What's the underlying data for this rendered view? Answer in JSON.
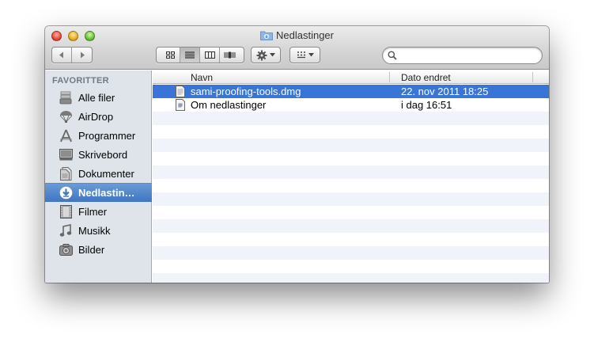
{
  "window": {
    "title": "Nedlastinger",
    "title_icon": "downloads-folder-icon"
  },
  "toolbar": {
    "back_icon": "chevron-left-icon",
    "forward_icon": "chevron-right-icon",
    "view_modes": [
      "icon-view",
      "list-view",
      "column-view",
      "cover-flow-view"
    ],
    "active_view": "list-view",
    "action_icon": "gear-icon",
    "arrange_icon": "arrange-icon",
    "search": {
      "value": "",
      "placeholder": ""
    }
  },
  "sidebar": {
    "heading": "FAVORITTER",
    "items": [
      {
        "label": "Alle filer",
        "icon": "all-files-icon",
        "selected": false
      },
      {
        "label": "AirDrop",
        "icon": "airdrop-icon",
        "selected": false
      },
      {
        "label": "Programmer",
        "icon": "applications-icon",
        "selected": false
      },
      {
        "label": "Skrivebord",
        "icon": "desktop-icon",
        "selected": false
      },
      {
        "label": "Dokumenter",
        "icon": "documents-icon",
        "selected": false
      },
      {
        "label": "Nedlastin…",
        "icon": "downloads-icon",
        "selected": true
      },
      {
        "label": "Filmer",
        "icon": "movies-icon",
        "selected": false
      },
      {
        "label": "Musikk",
        "icon": "music-icon",
        "selected": false
      },
      {
        "label": "Bilder",
        "icon": "pictures-icon",
        "selected": false
      }
    ]
  },
  "list": {
    "columns": {
      "name": "Navn",
      "date": "Dato endret"
    },
    "rows": [
      {
        "name": "sami-proofing-tools.dmg",
        "date": "22. nov 2011 18:25",
        "selected": true,
        "icon": "disk-image-icon"
      },
      {
        "name": "Om nedlastinger",
        "date": "i dag 16:51",
        "selected": false,
        "icon": "document-icon"
      }
    ]
  },
  "colors": {
    "selection": "#3875d7",
    "sidebar_bg": "#dee4ea",
    "sidebar_selection": "#4a80c8",
    "alt_row": "#f0f4fa"
  }
}
